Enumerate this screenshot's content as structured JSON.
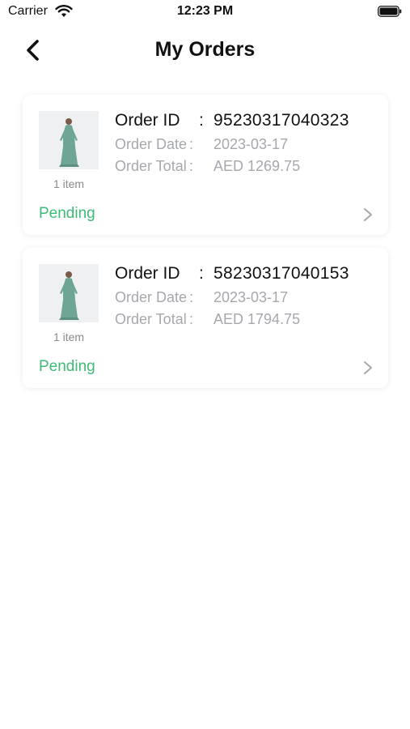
{
  "status_bar": {
    "carrier": "Carrier",
    "time": "12:23 PM"
  },
  "header": {
    "title": "My Orders",
    "back_icon": "chevron-left-icon"
  },
  "orders": [
    {
      "order_id_label": "Order ID",
      "order_id_sep": ":",
      "order_id": "95230317040323",
      "order_date_label": "Order Date",
      "order_date_sep": ":",
      "order_date": "2023-03-17",
      "order_total_label": "Order Total",
      "order_total_sep": ":",
      "order_total": "AED 1269.75",
      "item_count": "1 item",
      "status": "Pending"
    },
    {
      "order_id_label": "Order ID",
      "order_id_sep": ":",
      "order_id": "58230317040153",
      "order_date_label": "Order Date",
      "order_date_sep": ":",
      "order_date": "2023-03-17",
      "order_total_label": "Order Total",
      "order_total_sep": ":",
      "order_total": "AED 1794.75",
      "item_count": "1 item",
      "status": "Pending"
    }
  ],
  "colors": {
    "status_pending": "#3dbb77",
    "label_gray": "#a6a8ad",
    "dress_green": "#6fa595"
  }
}
